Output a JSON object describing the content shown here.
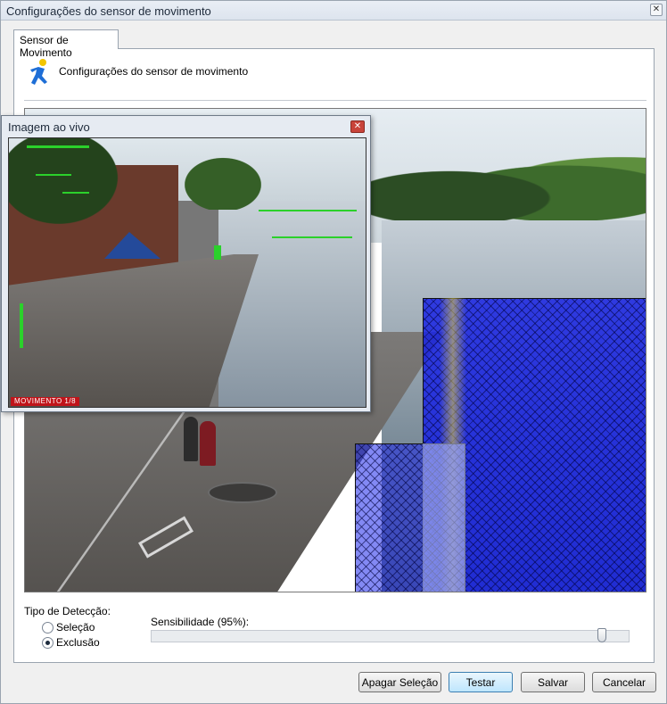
{
  "window": {
    "title": "Configurações do sensor de movimento"
  },
  "tab": {
    "label": "Sensor de Movimento"
  },
  "header": {
    "text": "Configurações do sensor de movimento",
    "icon": "running-person-icon",
    "icon_color": "#1e6ed6"
  },
  "live_view": {
    "title": "Imagem ao vivo",
    "badge": "MOVIMENTO 1/8"
  },
  "detection": {
    "label": "Tipo de Detecção:",
    "options": [
      {
        "label": "Seleção",
        "checked": false
      },
      {
        "label": "Exclusão",
        "checked": true
      }
    ]
  },
  "sensitivity": {
    "label": "Sensibilidade (95%):",
    "value": 95
  },
  "buttons": {
    "clear": "Apagar Seleção",
    "test": "Testar",
    "save": "Salvar",
    "cancel": "Cancelar"
  },
  "colors": {
    "selection_overlay": "#1a1ee6",
    "motion_highlight": "#2bd12b",
    "badge_bg": "#c0141a"
  }
}
